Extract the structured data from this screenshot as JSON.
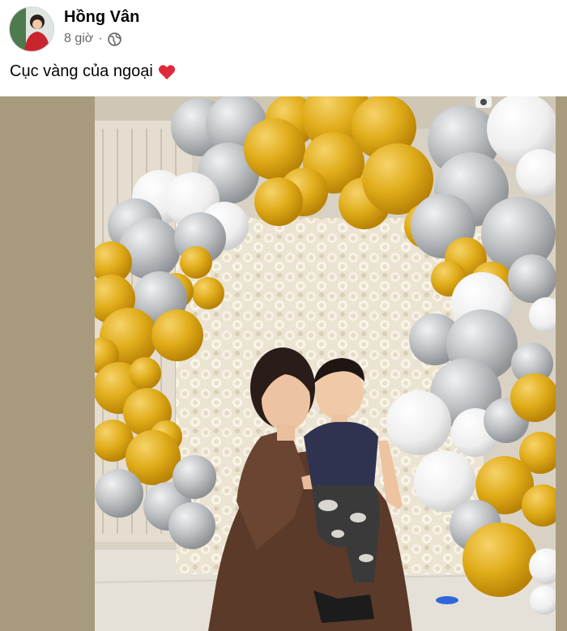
{
  "post": {
    "author": "Hồng Vân",
    "time": "8 giờ",
    "separator": "·",
    "caption": "Cục vàng của ngoại",
    "privacy_icon": "globe-icon",
    "emoji_icon": "red-heart-icon"
  },
  "colors": {
    "gold_balloon": "#e0ac19",
    "silver_balloon": "#b7babd",
    "white_balloon": "#eeeeee",
    "side_background": "#a89a7d",
    "heart": "#e0283a"
  }
}
